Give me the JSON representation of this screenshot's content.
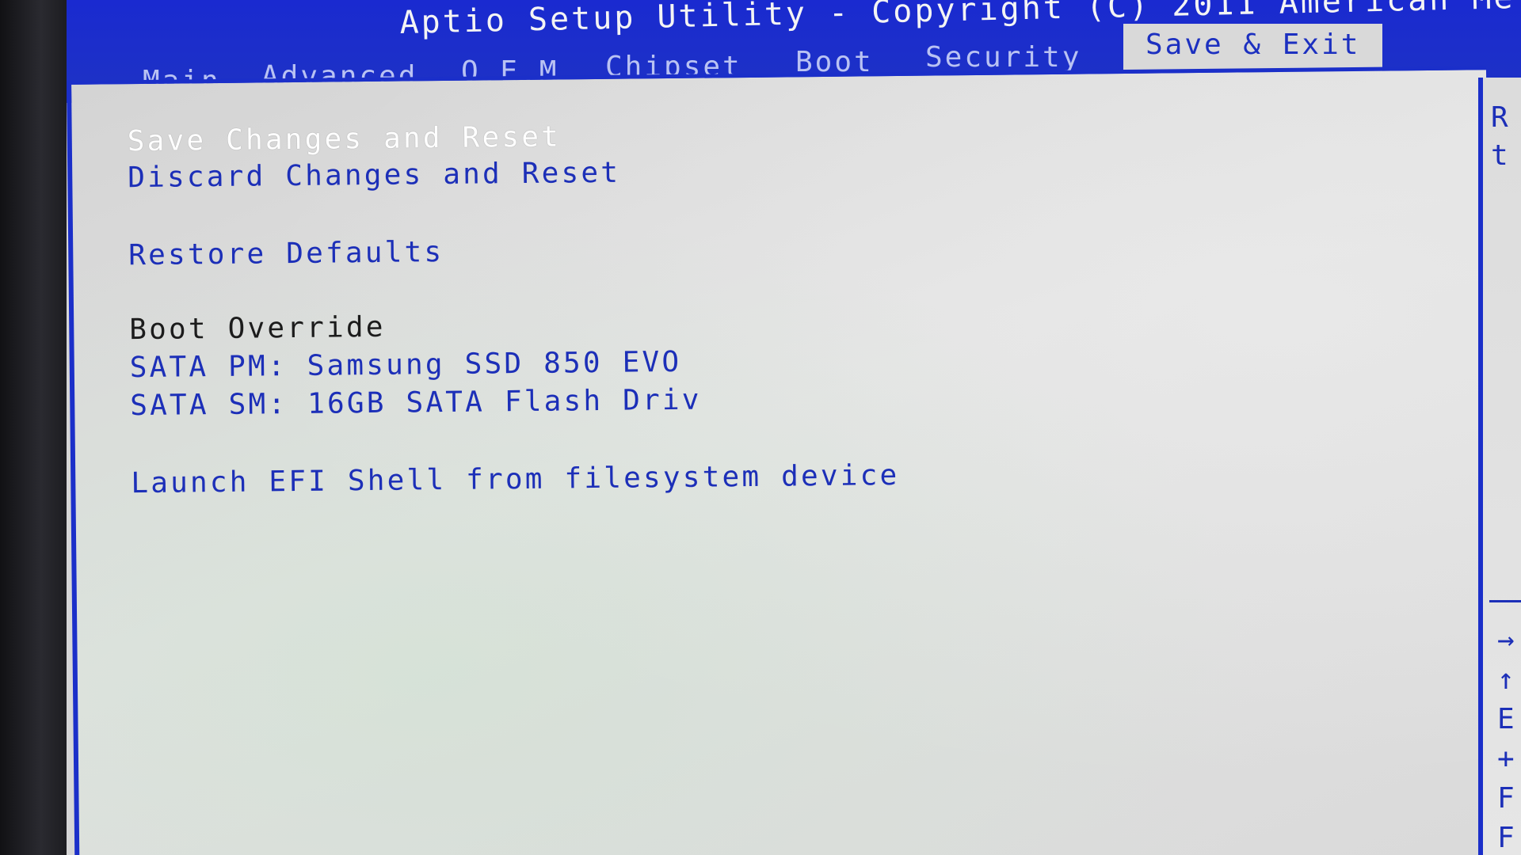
{
  "title": "Aptio Setup Utility - Copyright (C) 2011 American Me",
  "tabs": [
    {
      "label": "Main"
    },
    {
      "label": "Advanced"
    },
    {
      "label": "O.E.M"
    },
    {
      "label": "Chipset"
    },
    {
      "label": "Boot"
    },
    {
      "label": "Security"
    },
    {
      "label": "Save & Exit"
    }
  ],
  "active_tab": "Save & Exit",
  "menu": {
    "save_changes_reset": "Save Changes and Reset",
    "discard_changes_reset": "Discard Changes and Reset",
    "restore_defaults": "Restore Defaults",
    "boot_override": "Boot Override",
    "boot_option_1": "SATA  PM: Samsung SSD 850 EVO",
    "boot_option_2": "SATA  SM: 16GB SATA Flash Driv",
    "launch_efi_shell": "Launch EFI Shell from filesystem device"
  },
  "help_panel": {
    "line1": "R",
    "line2": "t",
    "key1": "→",
    "key2": "↑",
    "key3": "E",
    "key4": "+",
    "key5": "F",
    "key6": "F"
  },
  "colors": {
    "bios_blue": "#1b2fc9",
    "background_gray": "#d6d6d6",
    "highlight_white": "#ffffff"
  }
}
